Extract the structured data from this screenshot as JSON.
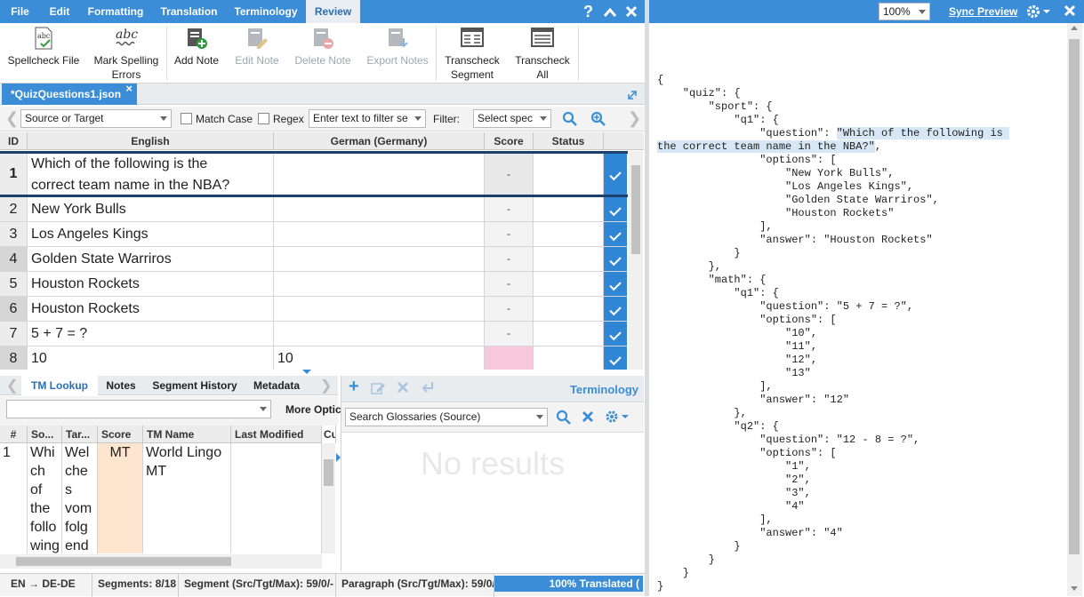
{
  "menubar": {
    "items": [
      "File",
      "Edit",
      "Formatting",
      "Translation",
      "Terminology",
      "Review"
    ],
    "active": "Review"
  },
  "ribbon": {
    "spellcheck_file": "Spellcheck File",
    "mark_spelling_errors_1": "Mark Spelling",
    "mark_spelling_errors_2": "Errors",
    "add_note": "Add Note",
    "edit_note": "Edit Note",
    "delete_note": "Delete Note",
    "export_notes": "Export Notes",
    "transcheck_segment_1": "Transcheck",
    "transcheck_segment_2": "Segment",
    "transcheck_all_1": "Transcheck",
    "transcheck_all_2": "All",
    "abc": "abc"
  },
  "doc_tab": {
    "label": "*QuizQuestions1.json",
    "close": "×"
  },
  "filter": {
    "scope": "Source or Target",
    "match_case": "Match Case",
    "regex": "Regex",
    "filter_placeholder": "Enter text to filter se",
    "filter_label": "Filter:",
    "filter_select": "Select spec"
  },
  "grid": {
    "headers": {
      "id": "ID",
      "english": "English",
      "german": "German (Germany)",
      "score": "Score",
      "status": "Status"
    },
    "rows": [
      {
        "id": "1",
        "en_line1": "Which of the following is the",
        "en_line2": "correct team name in the NBA?",
        "de": "",
        "score": "-"
      },
      {
        "id": "2",
        "en": "New York Bulls",
        "de": "",
        "score": "-"
      },
      {
        "id": "3",
        "en": "Los Angeles Kings",
        "de": "",
        "score": "-"
      },
      {
        "id": "4",
        "en": "Golden State Warriros",
        "de": "",
        "score": "-"
      },
      {
        "id": "5",
        "en": "Houston Rockets",
        "de": "",
        "score": "-"
      },
      {
        "id": "6",
        "en": "Houston Rockets",
        "de": "",
        "score": "-"
      },
      {
        "id": "7",
        "en": "5 + 7 = ?",
        "de": "",
        "score": "-"
      },
      {
        "id": "8",
        "en": "10",
        "de": "10",
        "score": ""
      }
    ]
  },
  "bottom_left": {
    "tabs": [
      "TM Lookup",
      "Notes",
      "Segment History",
      "Metadata"
    ],
    "more_options": "More Optic",
    "headers": {
      "num": "#",
      "source": "So...",
      "target": "Tar...",
      "score": "Score",
      "tm_name": "TM Name",
      "last_modified": "Last Modified",
      "cu": "Cu"
    },
    "result": {
      "num": "1",
      "source_lines": [
        "Whi",
        "ch",
        "of",
        "the",
        "follo",
        "wing"
      ],
      "target_lines": [
        "Wel",
        "che",
        "s",
        "vom",
        "folg",
        "end"
      ],
      "score": "MT",
      "tm_name_lines": [
        "World Lingo",
        "MT"
      ]
    }
  },
  "terminology": {
    "title": "Terminology",
    "search_placeholder": "Search Glossaries (Source)",
    "no_results": "No results"
  },
  "statusbar": {
    "lang": "EN → DE-DE",
    "segments": "Segments: 8/18",
    "segment": "Segment (Src/Tgt/Max): 59/0/-",
    "paragraph": "Paragraph (Src/Tgt/Max): 59/0/-",
    "translated": "100% Translated ("
  },
  "right_toolbar": {
    "zoom": "100%",
    "sync_preview": "Sync Preview"
  },
  "preview": {
    "lines": [
      "{",
      "    \"quiz\": {",
      "        \"sport\": {",
      "            \"q1\": {",
      "                \"question\": \"Which of the following is",
      "the correct team name in the NBA?\",",
      "                \"options\": [",
      "                    \"New York Bulls\",",
      "                    \"Los Angeles Kings\",",
      "                    \"Golden State Warriros\",",
      "                    \"Houston Rockets\"",
      "                ],",
      "                \"answer\": \"Houston Rockets\"",
      "            }",
      "        },",
      "        \"math\": {",
      "            \"q1\": {",
      "                \"question\": \"5 + 7 = ?\",",
      "                \"options\": [",
      "                    \"10\",",
      "                    \"11\",",
      "                    \"12\",",
      "                    \"13\"",
      "                ],",
      "                \"answer\": \"12\"",
      "            },",
      "            \"q2\": {",
      "                \"question\": \"12 - 8 = ?\",",
      "                \"options\": [",
      "                    \"1\",",
      "                    \"2\",",
      "                    \"3\",",
      "                    \"4\"",
      "                ],",
      "                \"answer\": \"4\"",
      "            }",
      "        }",
      "    }",
      "}"
    ]
  }
}
